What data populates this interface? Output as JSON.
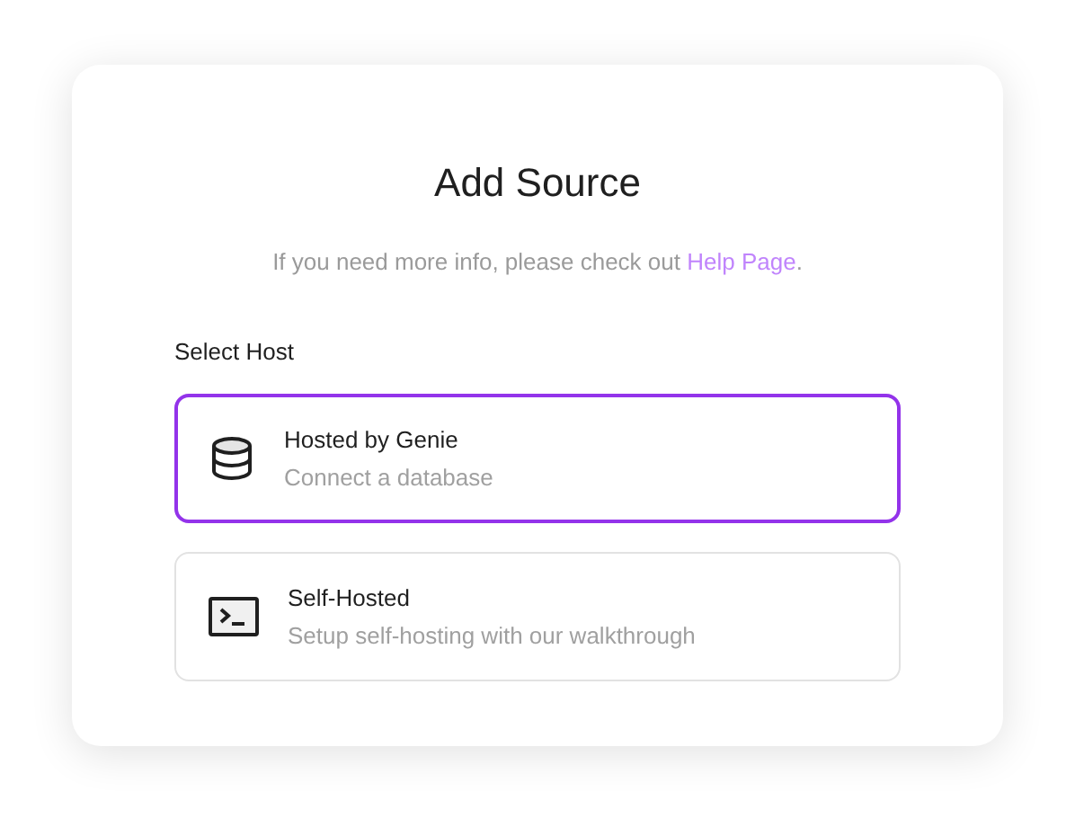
{
  "dialog": {
    "title": "Add Source",
    "subtitle": {
      "text": "If you need more info, please check out ",
      "link": "Help Page",
      "end": "."
    },
    "section_label": "Select Host",
    "options": [
      {
        "kind": "database",
        "title": "Hosted by Genie",
        "description": "Connect a database",
        "selected": true
      },
      {
        "kind": "terminal",
        "title": "Self-Hosted",
        "description": "Setup self-hosting with our walkthrough",
        "selected": false
      }
    ]
  }
}
